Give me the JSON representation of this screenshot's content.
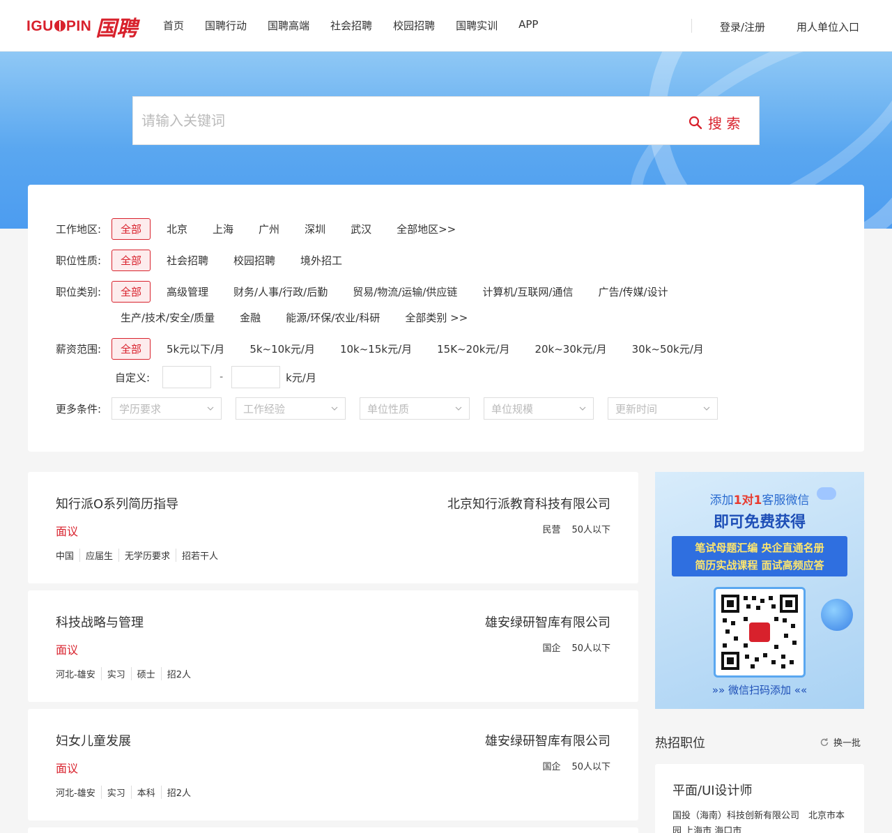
{
  "header": {
    "logo_en": "IGUOPIN",
    "logo_cn": "国聘",
    "nav": [
      "首页",
      "国聘行动",
      "国聘高端",
      "社会招聘",
      "校园招聘",
      "国聘实训",
      "APP"
    ],
    "login": "登录/注册",
    "employer": "用人单位入口"
  },
  "search": {
    "placeholder": "请输入关键词",
    "button": "搜 索"
  },
  "filters": {
    "location": {
      "label": "工作地区:",
      "options": [
        "全部",
        "北京",
        "上海",
        "广州",
        "深圳",
        "武汉",
        "全部地区>>"
      ]
    },
    "nature": {
      "label": "职位性质:",
      "options": [
        "全部",
        "社会招聘",
        "校园招聘",
        "境外招工"
      ]
    },
    "category": {
      "label": "职位类别:",
      "options": [
        "全部",
        "高级管理",
        "财务/人事/行政/后勤",
        "贸易/物流/运输/供应链",
        "计算机/互联网/通信",
        "广告/传媒/设计",
        "生产/技术/安全/质量",
        "金融",
        "能源/环保/农业/科研",
        "全部类别 >>"
      ]
    },
    "salary": {
      "label": "薪资范围:",
      "options": [
        "全部",
        "5k元以下/月",
        "5k~10k元/月",
        "10k~15k元/月",
        "15K~20k元/月",
        "20k~30k元/月",
        "30k~50k元/月"
      ]
    },
    "custom": {
      "label": "自定义:",
      "dash": "-",
      "unit": "k元/月"
    },
    "more": {
      "label": "更多条件:",
      "selects": [
        "学历要求",
        "工作经验",
        "单位性质",
        "单位规模",
        "更新时间"
      ]
    }
  },
  "jobs": [
    {
      "title": "知行派O系列简历指导",
      "salary": "面议",
      "tags": [
        "中国",
        "应届生",
        "无学历要求",
        "招若干人"
      ],
      "company": "北京知行派教育科技有限公司",
      "type": "民营",
      "size": "50人以下"
    },
    {
      "title": "科技战略与管理",
      "salary": "面议",
      "tags": [
        "河北-雄安",
        "实习",
        "硕士",
        "招2人"
      ],
      "company": "雄安绿研智库有限公司",
      "type": "国企",
      "size": "50人以下"
    },
    {
      "title": "妇女儿童发展",
      "salary": "面议",
      "tags": [
        "河北-雄安",
        "实习",
        "本科",
        "招2人"
      ],
      "company": "雄安绿研智库有限公司",
      "type": "国企",
      "size": "50人以下"
    }
  ],
  "ad": {
    "line1_pre": "添加",
    "line1_em": "1对1",
    "line1_post": "客服微信",
    "line2": "即可免费获得",
    "box_line1": "笔试母题汇编 央企直通名册",
    "box_line2": "简历实战课程 面试高频应答",
    "qr_badge": "国聘",
    "bottom": "»» 微信扫码添加 ««"
  },
  "hot": {
    "title": "热招职位",
    "refresh": "换一批",
    "job_title": "平面/UI设计师",
    "job_meta": "国投（海南）科技创新有限公司　北京市本园 上海市 海口市"
  },
  "colors": {
    "accent": "#d8212c",
    "banner": "#5aa7f0"
  }
}
